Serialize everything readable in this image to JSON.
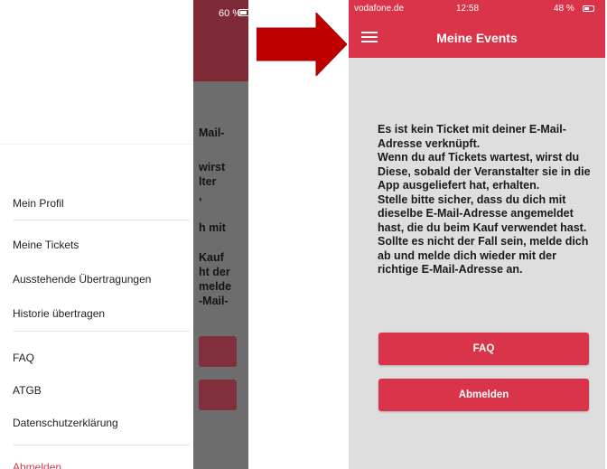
{
  "left_screen": {
    "status": {
      "battery": "60 %"
    },
    "drawer": {
      "items": [
        "Mein Profil",
        "Meine Tickets",
        "Ausstehende Übertragungen",
        "Historie übertragen",
        "FAQ",
        "ATGB",
        "Datenschutzerklärung",
        "Abmelden"
      ]
    },
    "background_text": [
      "Mail-",
      "wirst",
      "lter",
      ",",
      "h mit",
      "Kauf",
      "ht der",
      "melde",
      "-Mail-"
    ]
  },
  "right_screen": {
    "status": {
      "carrier": "vodafone.de",
      "time": "12:58",
      "battery": "48 %"
    },
    "title": "Meine Events",
    "message": [
      "Es ist kein Ticket mit deiner E-Mail-Adresse verknüpft.",
      "Wenn du auf Tickets wartest, wirst du Diese, sobald der Veranstalter sie in die App ausgeliefert hat, erhalten.",
      "Stelle bitte sicher, dass du dich mit dieselbe E-Mail-Adresse angemeldet hast, die du beim Kauf verwendet hast. Sollte es nicht der Fall sein, melde dich ab und melde dich wieder mit der richtige E-Mail-Adresse an."
    ],
    "faq_button": "FAQ",
    "logout_button": "Abmelden"
  },
  "colors": {
    "brand_red": "#d93449",
    "arrow_red": "#c00000",
    "drawer_logout": "#c9404f"
  }
}
